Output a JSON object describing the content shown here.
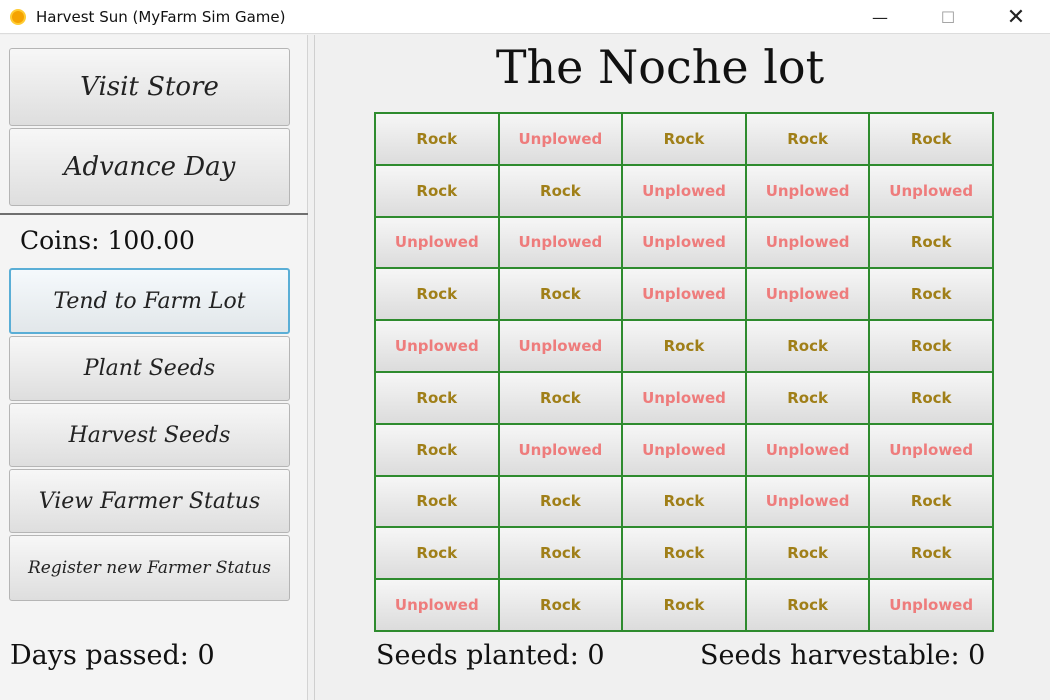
{
  "window": {
    "title": "Harvest Sun (MyFarm Sim Game)",
    "icon": "sun-icon",
    "controls": {
      "minimize": "—",
      "maximize": "☐",
      "close": "✕"
    }
  },
  "sidebar": {
    "visit_store": "Visit Store",
    "advance_day": "Advance Day",
    "coins": "Coins: 100.00",
    "tend_lot": "Tend to Farm Lot",
    "plant_seeds": "Plant Seeds",
    "harvest_seeds": "Harvest Seeds",
    "view_status": "View Farmer Status",
    "register_status": "Register new Farmer Status",
    "days_passed": "Days passed: 0"
  },
  "main": {
    "lot_title": "The Noche lot",
    "seeds_planted": "Seeds planted: 0",
    "seeds_harvestable": "Seeds harvestable: 0",
    "colors": {
      "rock": "#a07f18",
      "unplowed": "#ee7c7c",
      "grid_border": "#2e8b2e"
    },
    "tiles": [
      [
        "Rock",
        "Unplowed",
        "Rock",
        "Rock",
        "Rock"
      ],
      [
        "Rock",
        "Rock",
        "Unplowed",
        "Unplowed",
        "Unplowed"
      ],
      [
        "Unplowed",
        "Unplowed",
        "Unplowed",
        "Unplowed",
        "Rock"
      ],
      [
        "Rock",
        "Rock",
        "Unplowed",
        "Unplowed",
        "Rock"
      ],
      [
        "Unplowed",
        "Unplowed",
        "Rock",
        "Rock",
        "Rock"
      ],
      [
        "Rock",
        "Rock",
        "Unplowed",
        "Rock",
        "Rock"
      ],
      [
        "Rock",
        "Unplowed",
        "Unplowed",
        "Unplowed",
        "Unplowed"
      ],
      [
        "Rock",
        "Rock",
        "Rock",
        "Unplowed",
        "Rock"
      ],
      [
        "Rock",
        "Rock",
        "Rock",
        "Rock",
        "Rock"
      ],
      [
        "Unplowed",
        "Rock",
        "Rock",
        "Rock",
        "Unplowed"
      ]
    ]
  }
}
